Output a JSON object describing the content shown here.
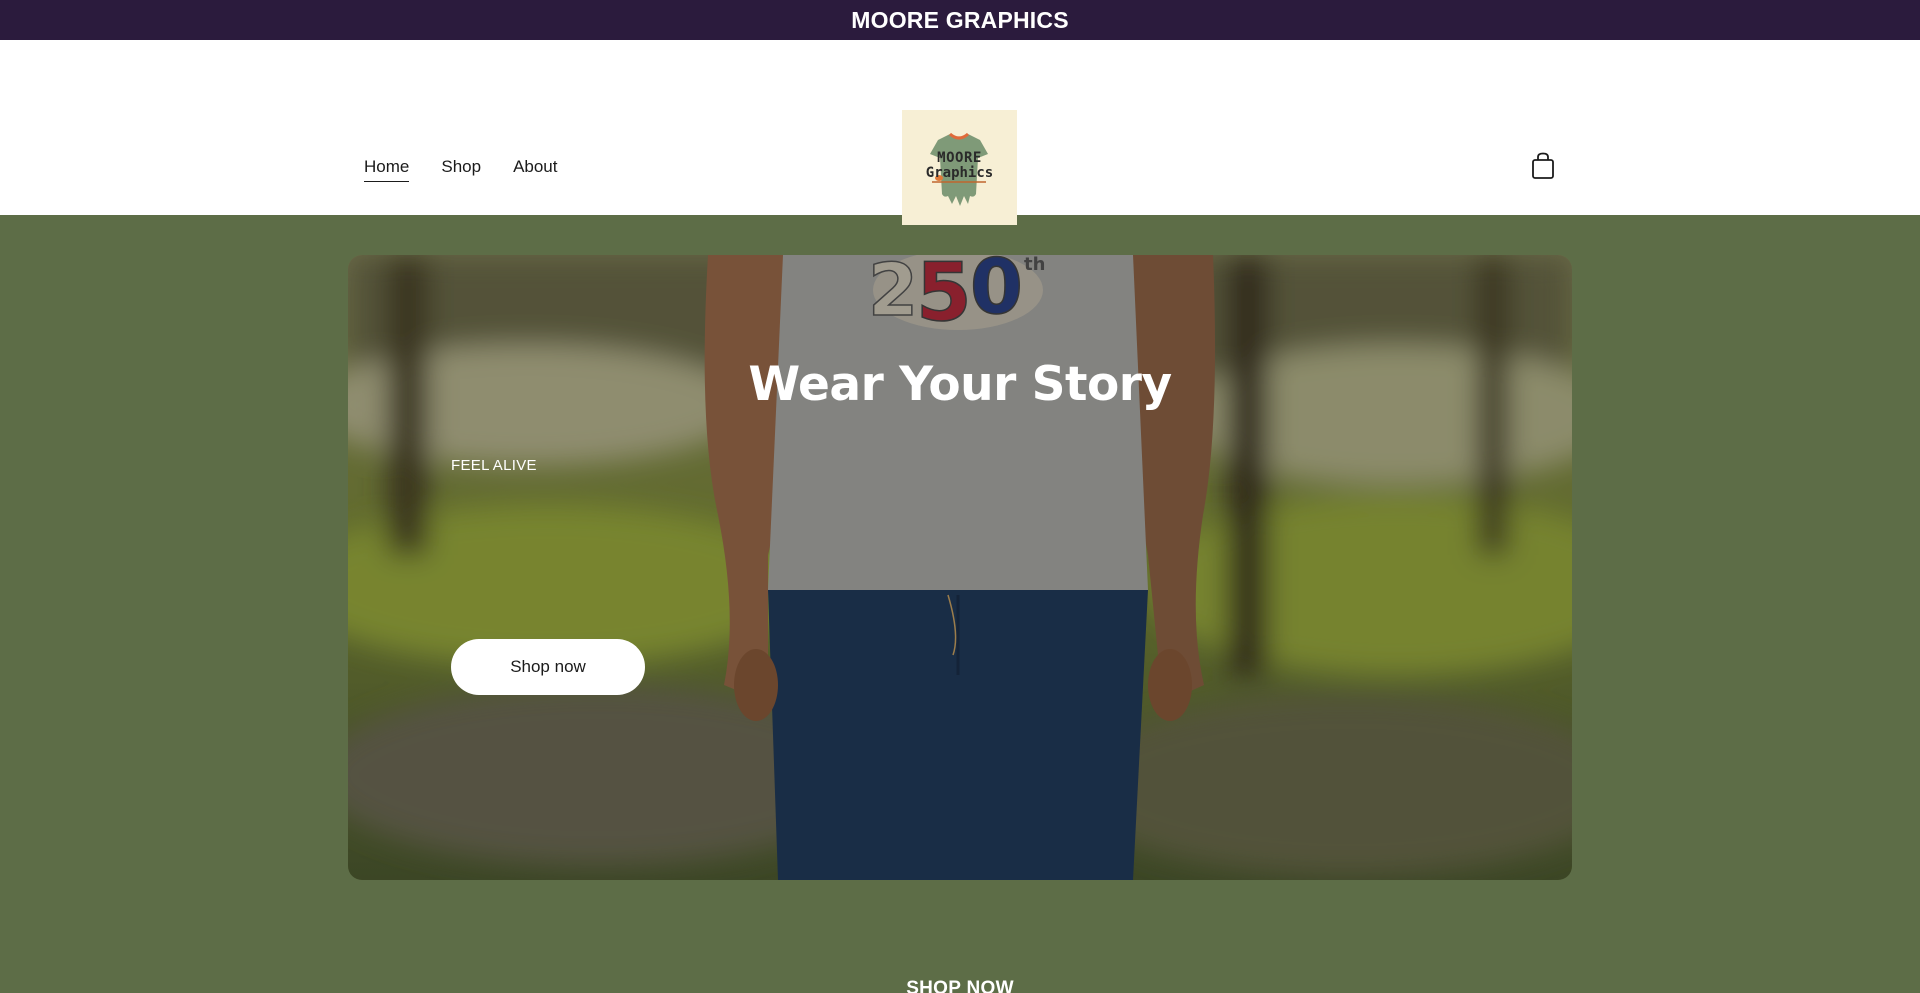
{
  "announcement": {
    "text": "MOORE GRAPHICS"
  },
  "nav": {
    "items": [
      {
        "label": "Home",
        "active": true
      },
      {
        "label": "Shop",
        "active": false
      },
      {
        "label": "About",
        "active": false
      }
    ]
  },
  "logo": {
    "line1": "MOORE",
    "line2": "Graphics"
  },
  "header": {
    "cart_icon": "shopping-bag-icon"
  },
  "hero": {
    "title": "Wear Your Story",
    "subtitle": "FEEL ALIVE",
    "button_label": "Shop now",
    "shirt_graphic": "250th"
  },
  "section": {
    "heading": "SHOP NOW"
  },
  "colors": {
    "announcement_bg": "#2b1b3d",
    "page_bg": "#5d6d47",
    "header_bg": "#ffffff",
    "logo_bg": "#f7efd5",
    "button_bg": "#ffffff"
  }
}
